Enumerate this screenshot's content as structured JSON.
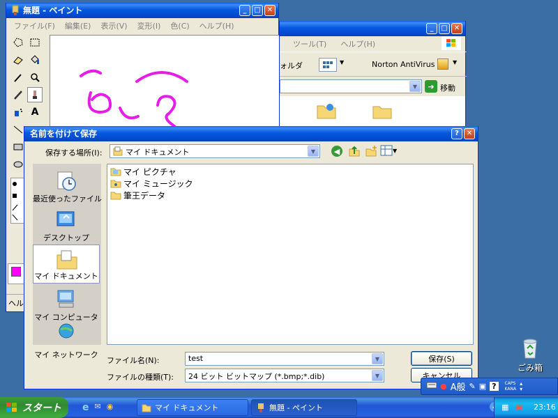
{
  "paint": {
    "title": "無題 - ペイント",
    "menu": [
      "ファイル(F)",
      "編集(E)",
      "表示(V)",
      "変形(I)",
      "色(C)",
      "ヘルプ(H)"
    ],
    "status": "ヘル",
    "colors": {
      "foreground": "#ff00ff",
      "stroke": "#e81ce8"
    }
  },
  "explorer": {
    "menu": [
      "ツール(T)",
      "ヘルプ(H)"
    ],
    "folder_label": "ォルダ",
    "norton_label": "Norton AntiVirus",
    "go_label": "移動"
  },
  "dialog": {
    "title": "名前を付けて保存",
    "save_in_label": "保存する場所(I):",
    "save_in_value": "マイ ドキュメント",
    "places": [
      {
        "label": "最近使ったファイル",
        "icon": "recent-documents-icon"
      },
      {
        "label": "デスクトップ",
        "icon": "desktop-icon"
      },
      {
        "label": "マイ ドキュメント",
        "icon": "my-documents-icon"
      },
      {
        "label": "マイ コンピュータ",
        "icon": "my-computer-icon"
      },
      {
        "label": "マイ ネットワーク",
        "icon": "my-network-icon"
      }
    ],
    "files": [
      {
        "name": "マイ ピクチャ",
        "icon": "my-pictures-folder-icon"
      },
      {
        "name": "マイ ミュージック",
        "icon": "my-music-folder-icon"
      },
      {
        "name": "筆王データ",
        "icon": "folder-icon"
      }
    ],
    "filename_label": "ファイル名(N):",
    "filename_value": "test",
    "filetype_label": "ファイルの種類(T):",
    "filetype_value": "24 ビット ビットマップ (*.bmp;*.dib)",
    "save_button": "保存(S)",
    "cancel_button": "キャンセル"
  },
  "desktop": {
    "recycle_bin_label": "ごみ箱"
  },
  "taskbar": {
    "start_label": "スタート",
    "tasks": [
      "マイ ドキュメント",
      "無題 - ペイント"
    ],
    "clock": "23:16",
    "ime_label": "A般",
    "caps_label": "CAPS",
    "kana_label": "KANA"
  }
}
